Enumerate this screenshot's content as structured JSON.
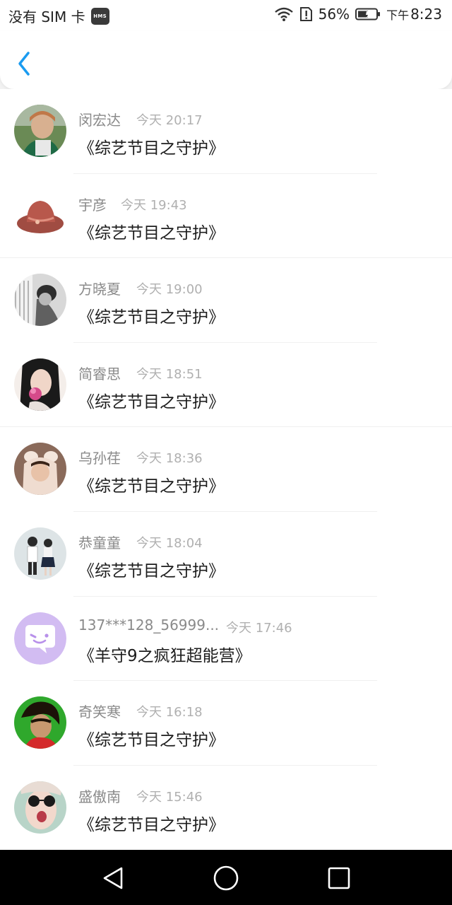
{
  "status_bar": {
    "carrier": "没有 SIM 卡",
    "hms_badge": "HMS",
    "battery_percent": "56%",
    "time_period": "下午",
    "time": "8:23"
  },
  "messages": [
    {
      "name": "闵宏达",
      "time": "今天 20:17",
      "title": "《综艺节目之守护》",
      "avatar": "avatar-photo"
    },
    {
      "name": "宇彦",
      "time": "今天 19:43",
      "title": "《综艺节目之守护》",
      "avatar": "cowboy-hat"
    },
    {
      "name": "方晓夏",
      "time": "今天 19:00",
      "title": "《综艺节目之守护》",
      "avatar": "avatar-photo"
    },
    {
      "name": "简睿思",
      "time": "今天 18:51",
      "title": "《综艺节目之守护》",
      "avatar": "avatar-photo"
    },
    {
      "name": "乌孙荏",
      "time": "今天 18:36",
      "title": "《综艺节目之守护》",
      "avatar": "avatar-photo"
    },
    {
      "name": "恭童童",
      "time": "今天 18:04",
      "title": "《综艺节目之守护》",
      "avatar": "avatar-photo"
    },
    {
      "name": "137***128_56999...",
      "time": "今天 17:46",
      "title": "《羊守9之疯狂超能营》",
      "avatar": "chat-bubble"
    },
    {
      "name": "奇笑寒",
      "time": "今天 16:18",
      "title": "《综艺节目之守护》",
      "avatar": "avatar-photo"
    },
    {
      "name": "盛傲南",
      "time": "今天 15:46",
      "title": "《综艺节目之守护》",
      "avatar": "avatar-photo"
    }
  ],
  "colors": {
    "accent": "#1a9bf0",
    "chat_avatar_bg": "#d2bcf2"
  },
  "icons": {
    "back": "back-arrow-icon",
    "nav_back": "triangle-back-icon",
    "nav_home": "circle-home-icon",
    "nav_recent": "square-recent-icon"
  }
}
